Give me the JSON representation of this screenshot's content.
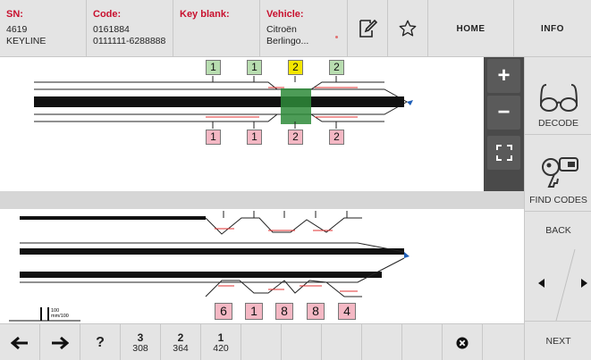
{
  "header": {
    "sn": {
      "label": "SN:",
      "line1": "4619",
      "line2": "KEYLINE"
    },
    "code": {
      "label": "Code:",
      "line1": "0161884",
      "line2": "0111111-6288888"
    },
    "key_blank": {
      "label": "Key blank:"
    },
    "vehicle": {
      "label": "Vehicle:",
      "line1": "Citroën",
      "line2": "Berlingo..."
    },
    "home_label": "HOME",
    "info_label": "INFO"
  },
  "sidebar": {
    "decode_label": "DECODE",
    "find_codes_label": "FIND CODES",
    "back_label": "BACK",
    "next_label": "NEXT"
  },
  "zoom": {
    "in_symbol": "+",
    "out_symbol": "−"
  },
  "top_key": {
    "top_cuts": [
      "1",
      "1",
      "2",
      "2"
    ],
    "bottom_cuts": [
      "1",
      "1",
      "2",
      "2"
    ]
  },
  "bottom_key": {
    "cuts": [
      "6",
      "1",
      "8",
      "8",
      "4"
    ],
    "scale_label_1": "100",
    "scale_label_2": "mm/100"
  },
  "toolbar": {
    "help_label": "?",
    "depths": [
      {
        "num": "3",
        "val": "308"
      },
      {
        "num": "2",
        "val": "364"
      },
      {
        "num": "1",
        "val": "420"
      }
    ]
  },
  "colors": {
    "brand_red": "#c8102e",
    "panel": "#e4e4e4",
    "active_green": "#2e8b3a",
    "cut_yellow": "#f4e600"
  }
}
